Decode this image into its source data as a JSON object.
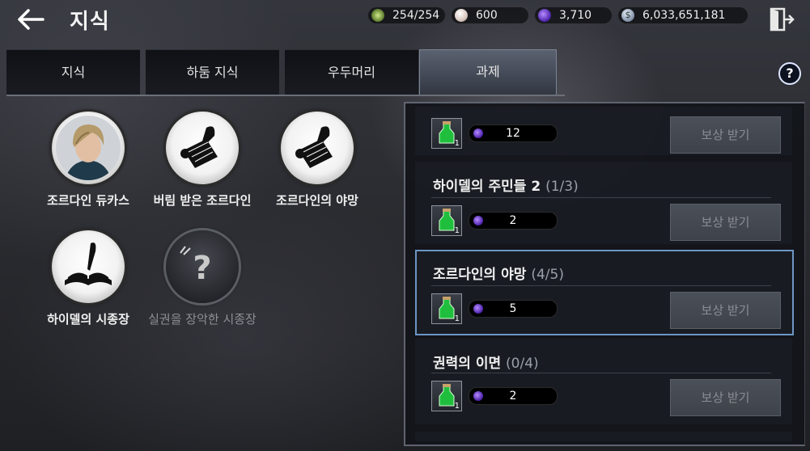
{
  "header": {
    "title": "지식",
    "resources": [
      {
        "icon": "energy-icon",
        "value": "254/254"
      },
      {
        "icon": "pearl-icon",
        "value": "600"
      },
      {
        "icon": "purple-orb-icon",
        "value": "3,710"
      },
      {
        "icon": "silver-coin-icon",
        "value": "6,033,651,181"
      }
    ]
  },
  "tabs": [
    {
      "label": "지식"
    },
    {
      "label": "하둠 지식"
    },
    {
      "label": "우두머리"
    },
    {
      "label": "과제"
    }
  ],
  "active_tab": "과제",
  "help_label": "?",
  "knowledge": [
    {
      "label": "조르다인 듀카스",
      "icon": "portrait-icon"
    },
    {
      "label": "버림 받은 조르다인",
      "icon": "scroll-quill-icon"
    },
    {
      "label": "조르다인의 야망",
      "icon": "scroll-quill-icon"
    },
    {
      "label": "하이델의 시종장",
      "icon": "book-quill-icon"
    },
    {
      "label": "실권을 장악한 시종장",
      "icon": "question-icon",
      "locked": true
    }
  ],
  "quests": [
    {
      "title": "",
      "progress": "",
      "reward_qty": "1",
      "count": "12",
      "button": "보상 받기"
    },
    {
      "title": "하이델의 주민들 2",
      "progress": "(1/3)",
      "reward_qty": "1",
      "count": "2",
      "button": "보상 받기"
    },
    {
      "title": "조르다인의 야망",
      "progress": "(4/5)",
      "reward_qty": "1",
      "count": "5",
      "button": "보상 받기",
      "selected": true
    },
    {
      "title": "권력의 이면",
      "progress": "(0/4)",
      "reward_qty": "1",
      "count": "2",
      "button": "보상 받기"
    }
  ],
  "colors": {
    "selected_border": "#6d95c4",
    "tab_active": "#4a505d"
  }
}
